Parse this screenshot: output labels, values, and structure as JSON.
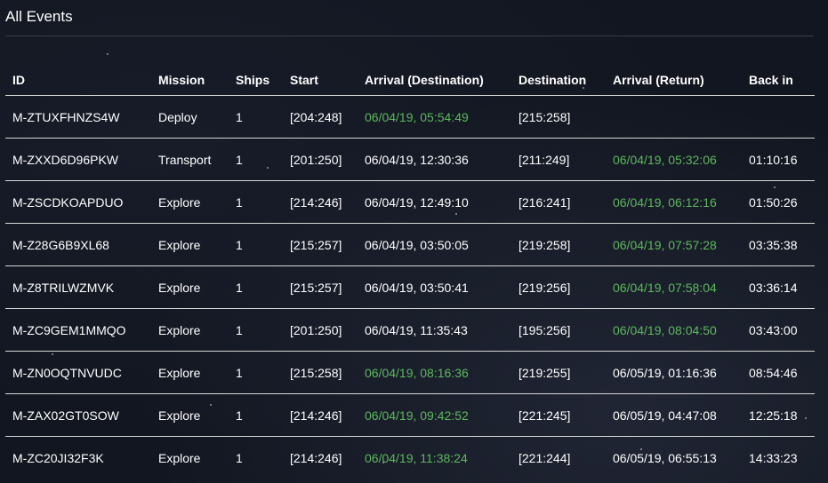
{
  "page": {
    "title": "All Events"
  },
  "table": {
    "columns": [
      "ID",
      "Mission",
      "Ships",
      "Start",
      "Arrival (Destination)",
      "Destination",
      "Arrival (Return)",
      "Back in"
    ],
    "rows": [
      {
        "id": "M-ZTUXFHNZS4W",
        "mission": "Deploy",
        "ships": "1",
        "start": "[204:248]",
        "arrival_destination": "06/04/19, 05:54:49",
        "arrival_destination_green": true,
        "destination": "[215:258]",
        "arrival_return": "",
        "arrival_return_green": false,
        "back_in": ""
      },
      {
        "id": "M-ZXXD6D96PKW",
        "mission": "Transport",
        "ships": "1",
        "start": "[201:250]",
        "arrival_destination": "06/04/19, 12:30:36",
        "arrival_destination_green": false,
        "destination": "[211:249]",
        "arrival_return": "06/04/19, 05:32:06",
        "arrival_return_green": true,
        "back_in": "01:10:16"
      },
      {
        "id": "M-ZSCDKOAPDUO",
        "mission": "Explore",
        "ships": "1",
        "start": "[214:246]",
        "arrival_destination": "06/04/19, 12:49:10",
        "arrival_destination_green": false,
        "destination": "[216:241]",
        "arrival_return": "06/04/19, 06:12:16",
        "arrival_return_green": true,
        "back_in": "01:50:26"
      },
      {
        "id": "M-Z28G6B9XL68",
        "mission": "Explore",
        "ships": "1",
        "start": "[215:257]",
        "arrival_destination": "06/04/19, 03:50:05",
        "arrival_destination_green": false,
        "destination": "[219:258]",
        "arrival_return": "06/04/19, 07:57:28",
        "arrival_return_green": true,
        "back_in": "03:35:38"
      },
      {
        "id": "M-Z8TRILWZMVK",
        "mission": "Explore",
        "ships": "1",
        "start": "[215:257]",
        "arrival_destination": "06/04/19, 03:50:41",
        "arrival_destination_green": false,
        "destination": "[219:256]",
        "arrival_return": "06/04/19, 07:58:04",
        "arrival_return_green": true,
        "back_in": "03:36:14"
      },
      {
        "id": "M-ZC9GEM1MMQO",
        "mission": "Explore",
        "ships": "1",
        "start": "[201:250]",
        "arrival_destination": "06/04/19, 11:35:43",
        "arrival_destination_green": false,
        "destination": "[195:256]",
        "arrival_return": "06/04/19, 08:04:50",
        "arrival_return_green": true,
        "back_in": "03:43:00"
      },
      {
        "id": "M-ZN0OQTNVUDC",
        "mission": "Explore",
        "ships": "1",
        "start": "[215:258]",
        "arrival_destination": "06/04/19, 08:16:36",
        "arrival_destination_green": true,
        "destination": "[219:255]",
        "arrival_return": "06/05/19, 01:16:36",
        "arrival_return_green": false,
        "back_in": "08:54:46"
      },
      {
        "id": "M-ZAX02GT0SOW",
        "mission": "Explore",
        "ships": "1",
        "start": "[214:246]",
        "arrival_destination": "06/04/19, 09:42:52",
        "arrival_destination_green": true,
        "destination": "[221:245]",
        "arrival_return": "06/05/19, 04:47:08",
        "arrival_return_green": false,
        "back_in": "12:25:18"
      },
      {
        "id": "M-ZC20JI32F3K",
        "mission": "Explore",
        "ships": "1",
        "start": "[214:246]",
        "arrival_destination": "06/04/19, 11:38:24",
        "arrival_destination_green": true,
        "destination": "[221:244]",
        "arrival_return": "06/05/19, 06:55:13",
        "arrival_return_green": false,
        "back_in": "14:33:23"
      }
    ]
  },
  "colors": {
    "background": "#121620",
    "text": "#ffffff",
    "highlight_green": "#5cb85c",
    "row_divider": "#d8d8d8"
  }
}
